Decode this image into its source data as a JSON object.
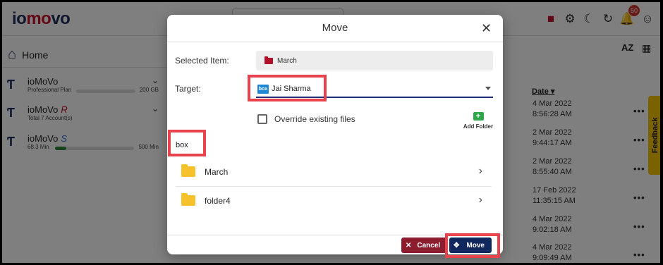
{
  "header": {
    "logo": {
      "part1": "io",
      "part2": "mo",
      "part3": "vo"
    },
    "notification_count": "50",
    "icons": [
      "video-icon",
      "gear-icon",
      "moon-icon",
      "refresh-icon",
      "bell-icon",
      "account-icon"
    ]
  },
  "sidebar": {
    "home_label": "Home",
    "accounts": [
      {
        "name": "ioMoVo",
        "suffix": "",
        "sub": "Professional Plan",
        "right": "200 GB",
        "usage_fraction": 0.0
      },
      {
        "name": "ioMoVo",
        "suffix": "R",
        "sub": "Total 7 Account(s)",
        "right": "",
        "usage_fraction": null
      },
      {
        "name": "ioMoVo",
        "suffix": "S",
        "sub": "68.3 Min",
        "right": "500 Min",
        "usage_fraction": 0.14
      }
    ]
  },
  "content": {
    "sort_label": "AZ",
    "date_header": "Date",
    "dates": [
      "4 Mar 2022 8:56:28 AM",
      "2 Mar 2022 9:44:17 AM",
      "2 Mar 2022 8:55:40 AM",
      "17 Feb 2022 11:35:15 AM",
      "4 Mar 2022 9:02:18 AM",
      "4 Mar 2022 9:09:49 AM"
    ],
    "more_label": "•••",
    "feedback_label": "Feedback"
  },
  "modal": {
    "title": "Move",
    "close_label": "✕",
    "selected_item_label": "Selected Item:",
    "selected_item_value": "March",
    "target_label": "Target:",
    "target_value": "Jai Sharma",
    "target_badge": "box",
    "override_label": "Override existing files",
    "add_folder_label": "Add Folder",
    "breadcrumb": "box",
    "folders": [
      {
        "name": "March"
      },
      {
        "name": "folder4"
      }
    ],
    "cancel_label": "Cancel",
    "move_label": "Move"
  }
}
